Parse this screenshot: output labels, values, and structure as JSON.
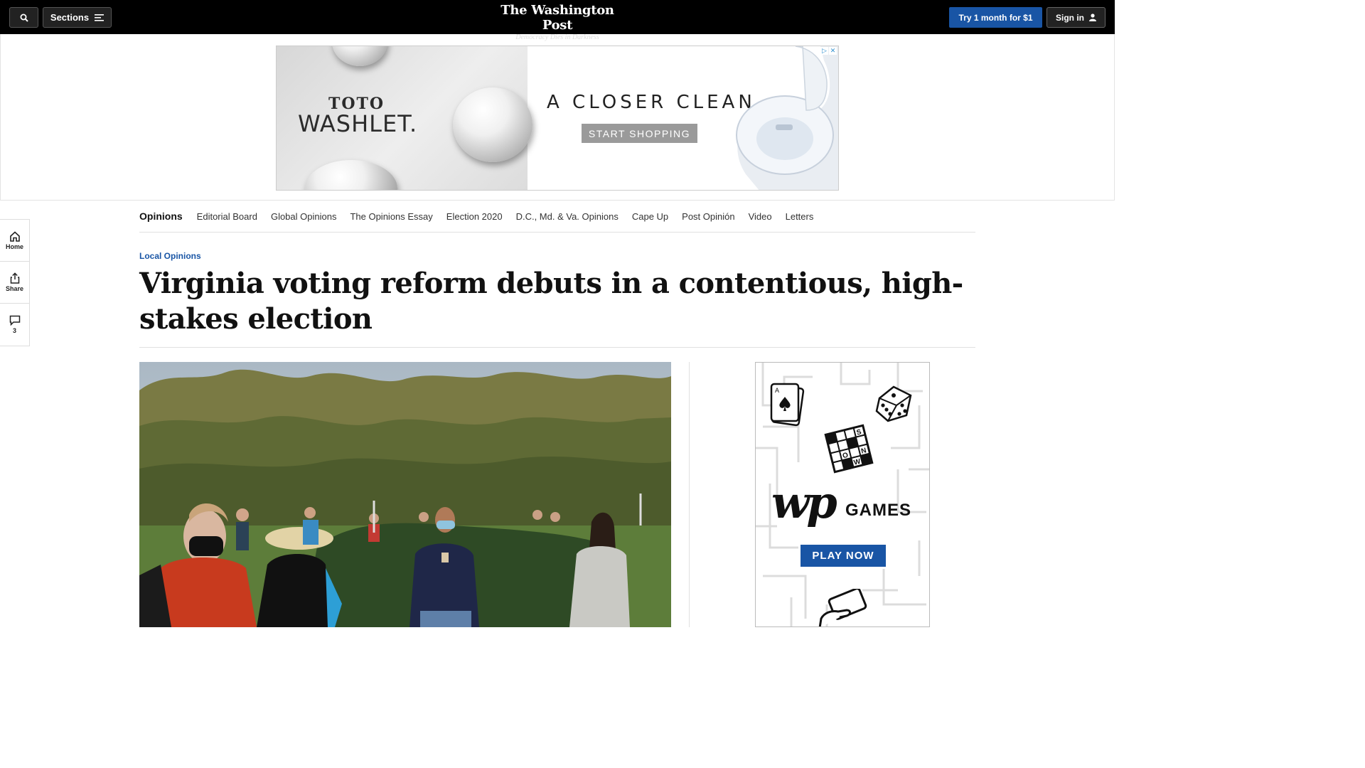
{
  "header": {
    "search_icon": "search-icon",
    "sections_label": "Sections",
    "logo_name": "The Washington Post",
    "logo_tagline": "Democracy Dies in Darkness",
    "try_label": "Try 1 month for $1",
    "signin_label": "Sign in"
  },
  "top_ad": {
    "brand_top": "TOTO",
    "brand_bottom": "WASHLET.",
    "headline": "A CLOSER CLEAN",
    "cta": "START SHOPPING"
  },
  "opinions_nav": {
    "items": [
      "Opinions",
      "Editorial Board",
      "Global Opinions",
      "The Opinions Essay",
      "Election 2020",
      "D.C., Md. & Va. Opinions",
      "Cape Up",
      "Post Opinión",
      "Video",
      "Letters"
    ]
  },
  "rail": {
    "home_label": "Home",
    "share_label": "Share",
    "comments_count": "3"
  },
  "article": {
    "kicker": "Local Opinions",
    "headline": "Virginia voting reform debuts in a contentious, high-stakes election"
  },
  "games_ad": {
    "logo": "wp",
    "word": "GAMES",
    "cta": "PLAY NOW"
  },
  "colors": {
    "topbar": "#000000",
    "accent_blue": "#1955a5"
  }
}
